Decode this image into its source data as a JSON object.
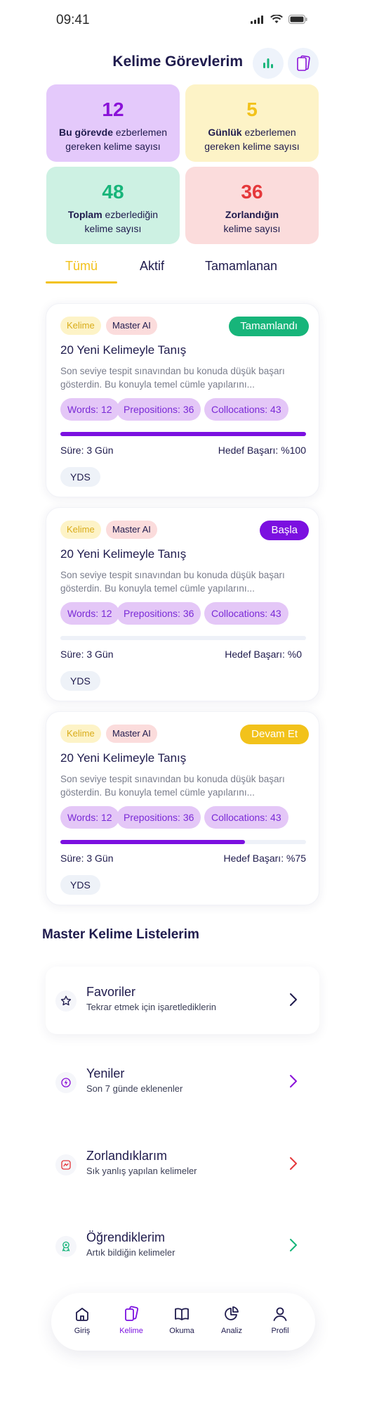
{
  "status_bar": {
    "time": "09:41"
  },
  "header": {
    "title": "Kelime Görevlerim"
  },
  "stats": [
    {
      "number": "12",
      "bold": "Bu görevde",
      "rest": " ezberlemen gereken kelime sayısı",
      "color": "#8a12d8",
      "bg": "#e4c9fb"
    },
    {
      "number": "5",
      "bold": "Günlük",
      "rest": " ezberlemen gereken kelime sayısı",
      "color": "#f2c21b",
      "bg": "#fdf3c7"
    },
    {
      "number": "48",
      "bold": "Toplam",
      "rest": " ezberlediğin kelime sayısı",
      "color": "#17b57a",
      "bg": "#cdf1e3"
    },
    {
      "number": "36",
      "bold": "Zorlandığın",
      "rest": " kelime sayısı",
      "color": "#e5383b",
      "bg": "#fbdcdc"
    }
  ],
  "tabs": [
    {
      "label": "Tümü",
      "active": true
    },
    {
      "label": "Aktif",
      "active": false
    },
    {
      "label": "Tamamlanan",
      "active": false
    }
  ],
  "tasks": [
    {
      "tags": [
        "Kelime",
        "Master AI"
      ],
      "status_label": "Tamamlandı",
      "status_color": "#17b57a",
      "title": "20 Yeni Kelimeyle Tanış",
      "description": "Son seviye tespit sınavından bu konuda düşük başarı gösterdin. Bu konuyla temel cümle yapılarını...",
      "pills": [
        "Words: 12",
        "Prepositions: 36",
        "Collocations: 43"
      ],
      "progress": 1.0,
      "duration": "Süre: 3 Gün",
      "target": "Hedef Başarı: %100",
      "exam": "YDS"
    },
    {
      "tags": [
        "Kelime",
        "Master AI"
      ],
      "status_label": "Başla",
      "status_color": "#7b10e0",
      "title": "20 Yeni Kelimeyle Tanış",
      "description": "Son seviye tespit sınavından bu konuda düşük başarı gösterdin. Bu konuyla temel cümle yapılarını...",
      "pills": [
        "Words: 12",
        "Prepositions: 36",
        "Collocations: 43"
      ],
      "progress": 0.0,
      "duration": "Süre: 3 Gün",
      "target": "Hedef Başarı: %0",
      "exam": "YDS"
    },
    {
      "tags": [
        "Kelime",
        "Master AI"
      ],
      "status_label": "Devam Et",
      "status_color": "#f2c21b",
      "title": "20 Yeni Kelimeyle Tanış",
      "description": "Son seviye tespit sınavından bu konuda düşük başarı gösterdin. Bu konuyla temel cümle yapılarını...",
      "pills": [
        "Words: 12",
        "Prepositions: 36",
        "Collocations: 43"
      ],
      "progress": 0.75,
      "duration": "Süre: 3 Gün",
      "target": "Hedef Başarı: %75",
      "exam": "YDS"
    }
  ],
  "lists_section": {
    "title": "Master Kelime Listelerim",
    "items": [
      {
        "title": "Favoriler",
        "subtitle": "Tekrar etmek için işaretlediklerin",
        "icon": "star-icon",
        "color": "#1f1b4d"
      },
      {
        "title": "Yeniler",
        "subtitle": "Son 7 günde eklenenler",
        "icon": "new-icon",
        "color": "#8a12d8"
      },
      {
        "title": "Zorlandıklarım",
        "subtitle": "Sık yanlış yapılan kelimeler",
        "icon": "struggle-icon",
        "color": "#e5383b"
      },
      {
        "title": "Öğrendiklerim",
        "subtitle": "Artık bildiğin kelimeler",
        "icon": "award-icon",
        "color": "#17b57a"
      }
    ]
  },
  "bottom_nav": [
    {
      "label": "Giriş",
      "icon": "home-icon",
      "active": false
    },
    {
      "label": "Kelime",
      "icon": "cards-icon",
      "active": true
    },
    {
      "label": "Okuma",
      "icon": "book-icon",
      "active": false
    },
    {
      "label": "Analiz",
      "icon": "pie-chart-icon",
      "active": false
    },
    {
      "label": "Profil",
      "icon": "user-icon",
      "active": false
    }
  ]
}
